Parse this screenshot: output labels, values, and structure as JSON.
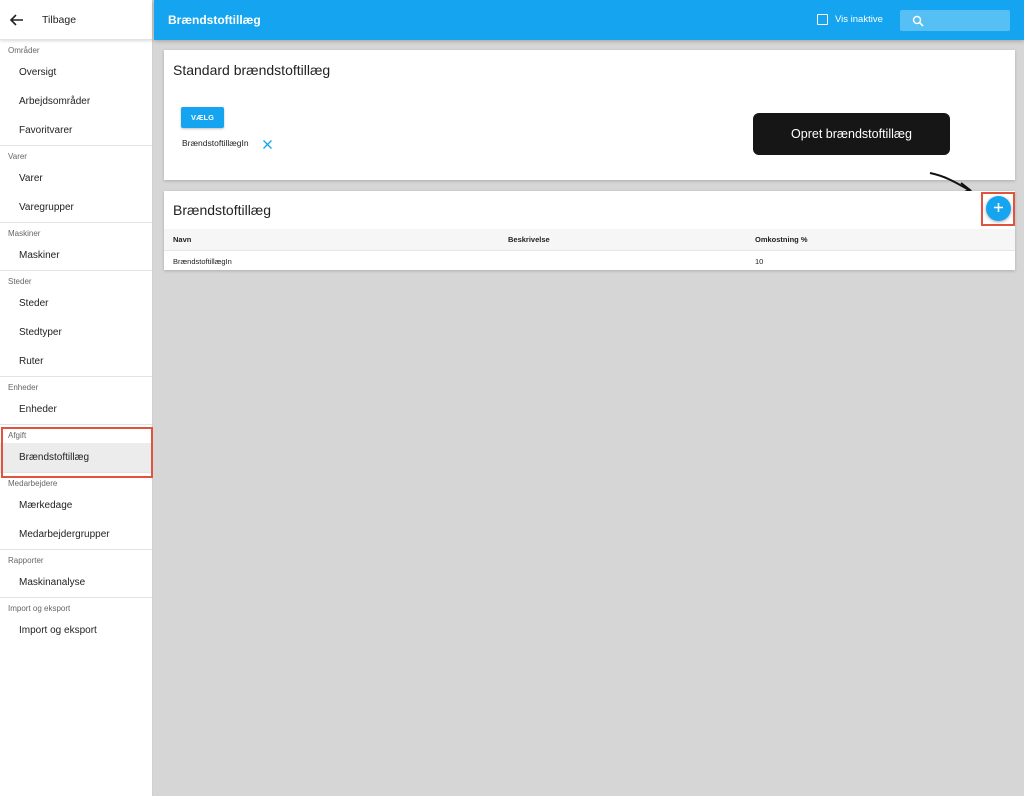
{
  "sidebar": {
    "back_label": "Tilbage",
    "sections": [
      {
        "title": "Områder",
        "items": [
          "Oversigt",
          "Arbejdsområder",
          "Favoritvarer"
        ]
      },
      {
        "title": "Varer",
        "items": [
          "Varer",
          "Varegrupper"
        ]
      },
      {
        "title": "Maskiner",
        "items": [
          "Maskiner"
        ]
      },
      {
        "title": "Steder",
        "items": [
          "Steder",
          "Stedtyper",
          "Ruter"
        ]
      },
      {
        "title": "Enheder",
        "items": [
          "Enheder"
        ]
      },
      {
        "title": "Afgift",
        "items": [
          "Brændstoftillæg"
        ]
      },
      {
        "title": "Medarbejdere",
        "items": [
          "Mærkedage",
          "Medarbejdergrupper"
        ]
      },
      {
        "title": "Rapporter",
        "items": [
          "Maskinanalyse"
        ]
      },
      {
        "title": "Import og eksport",
        "items": [
          "Import og eksport"
        ]
      }
    ],
    "active_item": "Brændstoftillæg"
  },
  "topbar": {
    "title": "Brændstoftillæg",
    "checkbox_label": "Vis inaktive",
    "search_placeholder": ""
  },
  "standard_card": {
    "title": "Standard brændstoftillæg",
    "button_label": "VÆLG",
    "selected_value": "BrændstoftillægIn"
  },
  "tooltip": {
    "text": "Opret brændstoftillæg"
  },
  "list_card": {
    "title": "Brændstoftillæg",
    "columns": [
      "Navn",
      "Beskrivelse",
      "Omkostning %"
    ],
    "rows": [
      [
        "BrændstoftillægIn",
        "",
        "10"
      ]
    ]
  },
  "colors": {
    "primary": "#14a4f0",
    "highlight": "#e0533f",
    "tooltip_bg": "#161616"
  }
}
